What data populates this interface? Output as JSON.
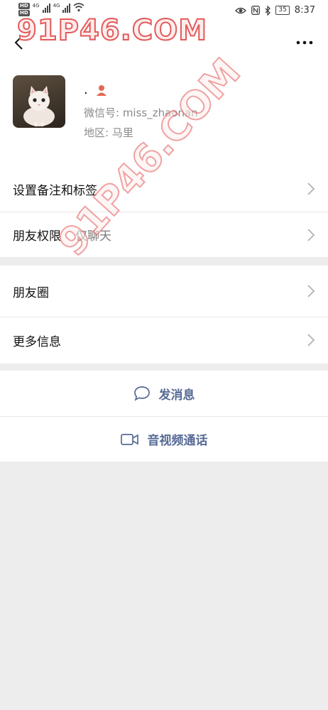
{
  "status_bar": {
    "hd1": "HD",
    "hd2": "HD",
    "net1": "4G",
    "net2": "4G",
    "battery": "35",
    "time": "8:37"
  },
  "watermark": {
    "text1": "91P46.COM",
    "text2": "91P46.COM"
  },
  "profile": {
    "nickname": ".",
    "wechat_id": "微信号: miss_zhaonan",
    "region": "地区: 马里",
    "gender_icon_color": "#e06a54"
  },
  "settings": {
    "items": [
      {
        "label": "设置备注和标签",
        "sub": ""
      },
      {
        "label": "朋友权限",
        "sub": "仅聊天"
      }
    ]
  },
  "social": {
    "items": [
      {
        "label": "朋友圈"
      },
      {
        "label": "更多信息"
      }
    ]
  },
  "actions": {
    "message": "发消息",
    "video_call": "音视频通话"
  },
  "colors": {
    "link_blue": "#576b95",
    "background": "#ededed"
  }
}
